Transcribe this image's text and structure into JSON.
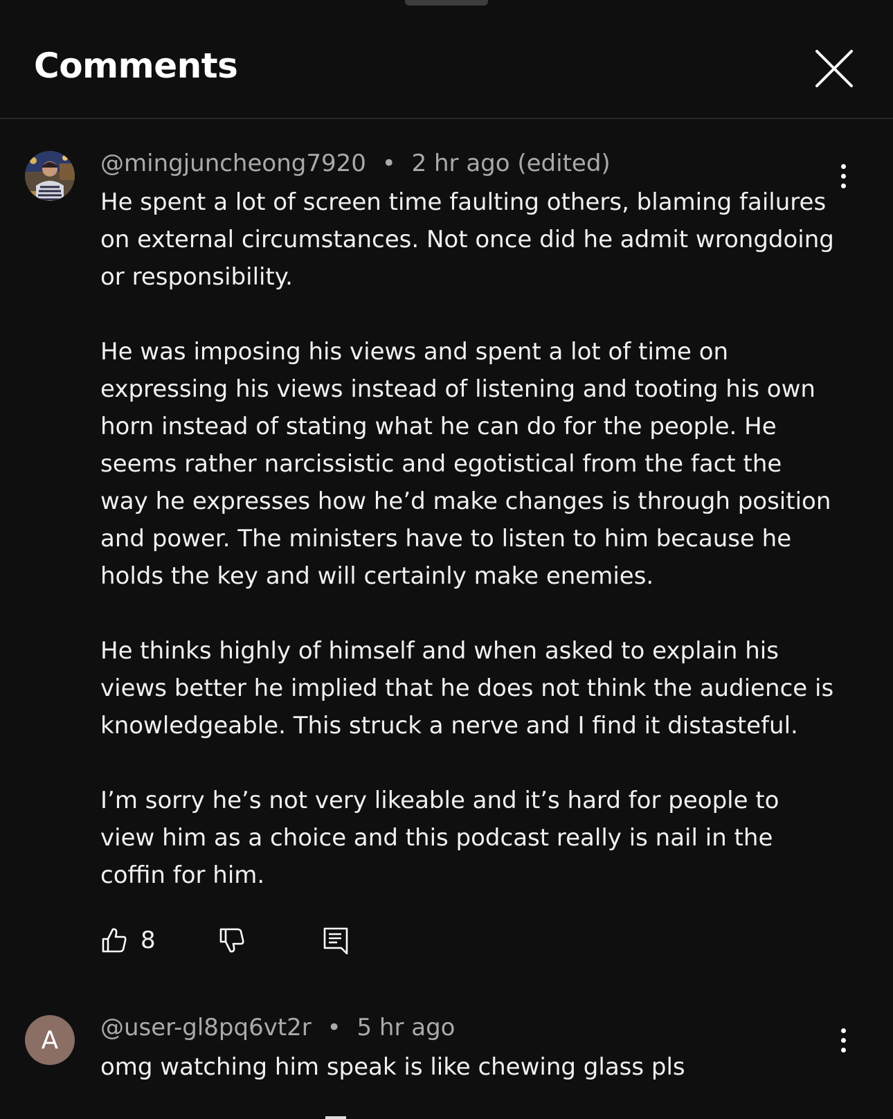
{
  "header": {
    "title": "Comments"
  },
  "comments": [
    {
      "username": "@mingjuncheong7920",
      "separator": "•",
      "time": "2 hr ago (edited)",
      "paragraphs": [
        "He spent a lot of screen time faulting others, blaming failures on external circumstances. Not once did he admit wrongdoing or responsibility.",
        "He was imposing his views and spent a lot of time on expressing his views instead of listening and tooting his own horn instead of stating what he can do for the people. He seems rather narcissistic and egotistical from the fact the way he expresses how he’d make changes is through position and power. The ministers have to listen to him because he holds the key and will certainly make enemies.",
        "He thinks highly of himself and when asked to explain his views better he implied that he does not think the audience is knowledgeable. This struck a nerve and I find it distasteful.",
        "I’m sorry he’s not very likeable and it’s hard for people to view him as a choice and this podcast really is nail in the coffin for him."
      ],
      "like_count": "8",
      "icons": {
        "avatar": "user-photo-avatar",
        "like": "thumb-up-icon",
        "dislike": "thumb-down-icon",
        "reply": "reply-comment-icon",
        "more": "more-vertical-icon"
      }
    },
    {
      "username": "@user-gl8pq6vt2r",
      "separator": "•",
      "time": "5 hr ago",
      "avatar_letter": "A",
      "text": "omg watching him speak is like chewing glass pls",
      "icons": {
        "more": "more-vertical-icon"
      }
    }
  ],
  "colors": {
    "background": "#0f0f10",
    "text": "#f1f1f1",
    "meta": "#aaaaaa",
    "avatar_letter_bg": "#8b6e64"
  }
}
